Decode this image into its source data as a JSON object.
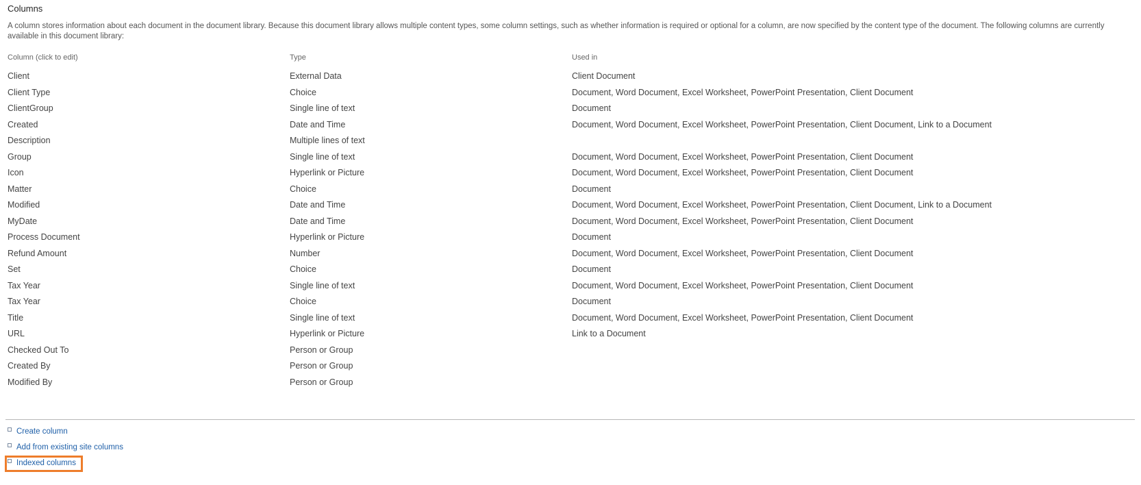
{
  "section": {
    "title": "Columns",
    "description": "A column stores information about each document in the document library. Because this document library allows multiple content types, some column settings, such as whether information is required or optional for a column, are now specified by the content type of the document. The following columns are currently available in this document library:"
  },
  "table": {
    "headers": {
      "column": "Column (click to edit)",
      "type": "Type",
      "used_in": "Used in"
    },
    "rows": [
      {
        "name": "Client",
        "type": "External Data",
        "used_in": "Client Document"
      },
      {
        "name": "Client Type",
        "type": "Choice",
        "used_in": "Document, Word Document, Excel Worksheet, PowerPoint Presentation, Client Document"
      },
      {
        "name": "ClientGroup",
        "type": "Single line of text",
        "used_in": "Document"
      },
      {
        "name": "Created",
        "type": "Date and Time",
        "used_in": "Document, Word Document, Excel Worksheet, PowerPoint Presentation, Client Document, Link to a Document"
      },
      {
        "name": "Description",
        "type": "Multiple lines of text",
        "used_in": ""
      },
      {
        "name": "Group",
        "type": "Single line of text",
        "used_in": "Document, Word Document, Excel Worksheet, PowerPoint Presentation, Client Document"
      },
      {
        "name": "Icon",
        "type": "Hyperlink or Picture",
        "used_in": "Document, Word Document, Excel Worksheet, PowerPoint Presentation, Client Document"
      },
      {
        "name": "Matter",
        "type": "Choice",
        "used_in": "Document"
      },
      {
        "name": "Modified",
        "type": "Date and Time",
        "used_in": "Document, Word Document, Excel Worksheet, PowerPoint Presentation, Client Document, Link to a Document"
      },
      {
        "name": "MyDate",
        "type": "Date and Time",
        "used_in": "Document, Word Document, Excel Worksheet, PowerPoint Presentation, Client Document"
      },
      {
        "name": "Process Document",
        "type": "Hyperlink or Picture",
        "used_in": "Document"
      },
      {
        "name": "Refund Amount",
        "type": "Number",
        "used_in": "Document, Word Document, Excel Worksheet, PowerPoint Presentation, Client Document"
      },
      {
        "name": "Set",
        "type": "Choice",
        "used_in": "Document"
      },
      {
        "name": "Tax Year",
        "type": "Single line of text",
        "used_in": "Document, Word Document, Excel Worksheet, PowerPoint Presentation, Client Document"
      },
      {
        "name": "Tax Year",
        "type": "Choice",
        "used_in": "Document"
      },
      {
        "name": "Title",
        "type": "Single line of text",
        "used_in": "Document, Word Document, Excel Worksheet, PowerPoint Presentation, Client Document"
      },
      {
        "name": "URL",
        "type": "Hyperlink or Picture",
        "used_in": "Link to a Document"
      },
      {
        "name": "Checked Out To",
        "type": "Person or Group",
        "used_in": ""
      },
      {
        "name": "Created By",
        "type": "Person or Group",
        "used_in": ""
      },
      {
        "name": "Modified By",
        "type": "Person or Group",
        "used_in": ""
      }
    ]
  },
  "actions": {
    "create_column": "Create column",
    "add_existing": "Add from existing site columns",
    "indexed_columns": "Indexed columns"
  },
  "colors": {
    "link": "#1e5fa8",
    "highlight": "#ee7d2b"
  }
}
